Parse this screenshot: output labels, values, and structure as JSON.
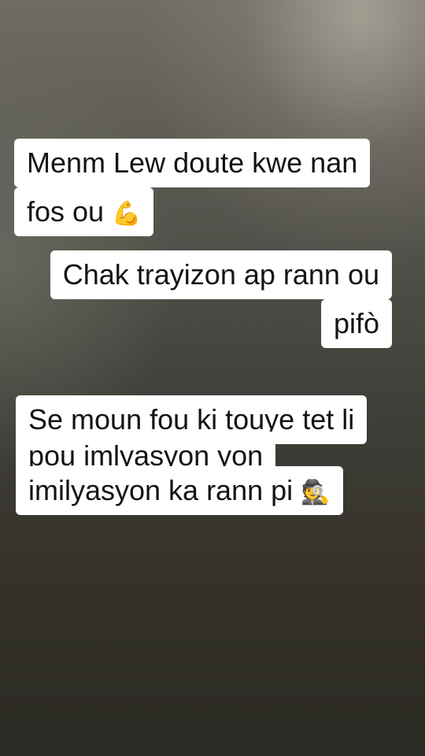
{
  "captions": [
    {
      "lines": [
        "Menm Lew doute kwe nan",
        "fos ou"
      ],
      "emoji": "💪"
    },
    {
      "lines": [
        "Chak trayizon ap rann ou",
        "pifò"
      ]
    },
    {
      "lines": [
        "Se moun fou ki touye tet li",
        "pou imlyasyon yon",
        "imilyasyon ka rann pi"
      ],
      "emoji": "🕵"
    }
  ]
}
